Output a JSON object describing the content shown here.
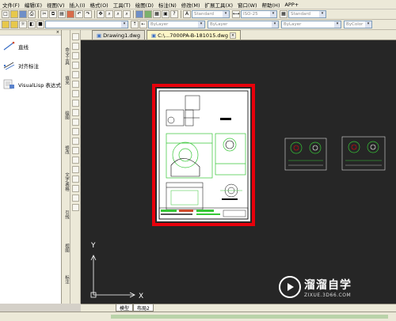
{
  "menu": [
    {
      "label": "文件(F)"
    },
    {
      "label": "编辑(E)"
    },
    {
      "label": "视图(V)"
    },
    {
      "label": "插入(I)"
    },
    {
      "label": "格式(O)"
    },
    {
      "label": "工具(T)"
    },
    {
      "label": "绘图(D)"
    },
    {
      "label": "标注(N)"
    },
    {
      "label": "修改(M)"
    },
    {
      "label": "扩展工具(X)"
    },
    {
      "label": "窗口(W)"
    },
    {
      "label": "帮助(H)"
    },
    {
      "label": "APP+"
    }
  ],
  "toolbar": {
    "style_combo": "Standard",
    "dim_combo": "ISO-25",
    "table_combo": "Standard",
    "layer_combo": "ByLayer",
    "linetype_combo": "ByLayer",
    "lineweight_combo": "ByLayer",
    "color_combo": "ByColor"
  },
  "left_panel": {
    "items": [
      {
        "label": "直线"
      },
      {
        "label": "对齐标注"
      },
      {
        "label": "VisualLisp 表达式"
      }
    ]
  },
  "vertical_tabs": [
    {
      "label": "命令工具"
    },
    {
      "label": "填充"
    },
    {
      "label": "绘图"
    },
    {
      "label": "修改"
    },
    {
      "label": "文字/表格"
    },
    {
      "label": "引线"
    },
    {
      "label": "视图"
    },
    {
      "label": "标注"
    }
  ],
  "document_tabs": [
    {
      "label": "Drawing1.dwg",
      "active": false
    },
    {
      "label": "C:\\...7000PA-B-181015.dwg",
      "active": true
    }
  ],
  "layout_tabs": [
    {
      "label": "模型"
    },
    {
      "label": "布局2"
    }
  ],
  "ucs": {
    "x_label": "X",
    "y_label": "Y"
  },
  "watermark": {
    "title": "溜溜自学",
    "subtitle": "ZIXUE.3D66.COM"
  },
  "colors": {
    "highlight_frame": "#e8000b",
    "canvas_bg": "#262626",
    "drawing_green": "#36c636"
  }
}
